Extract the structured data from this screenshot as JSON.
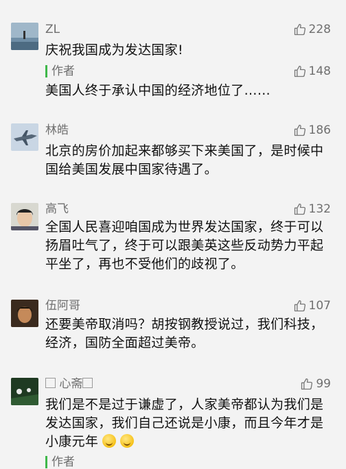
{
  "comments": [
    {
      "name": "ZL",
      "likes": "228",
      "text": "庆祝我国成为发达国家!",
      "reply": {
        "label": "作者",
        "likes": "148",
        "text": "美国人终于承认中国的经济地位了……"
      }
    },
    {
      "name": "林皓",
      "likes": "186",
      "text": "北京的房价加起来都够买下来美国了，是时候中国给美国发展中国家待遇了。"
    },
    {
      "name": "高飞",
      "likes": "132",
      "text": "全国人民喜迎咱国成为世界发达国家，终于可以扬眉吐气了，终于可以跟美英这些反动势力平起平坐了，再也不受他们的歧视了。"
    },
    {
      "name": "伍阿哥",
      "likes": "107",
      "text": "还要美帝取消吗？胡按钢教授说过，我们科技，经济，国防全面超过美帝。"
    },
    {
      "name": "心斋",
      "likes": "99",
      "text": "我们是不是过于谦虚了，人家美帝都认为我们是发达国家，我们自己还说是小康，而且今年才是小康元年",
      "emojis": [
        "grin-emoji",
        "grin-emoji"
      ]
    }
  ],
  "partial_reply_label": "作者",
  "icons": {
    "like": "thumbs-up-icon"
  },
  "colors": {
    "author_bar": "#3fb84a",
    "meta_text": "#6f6f6f"
  }
}
